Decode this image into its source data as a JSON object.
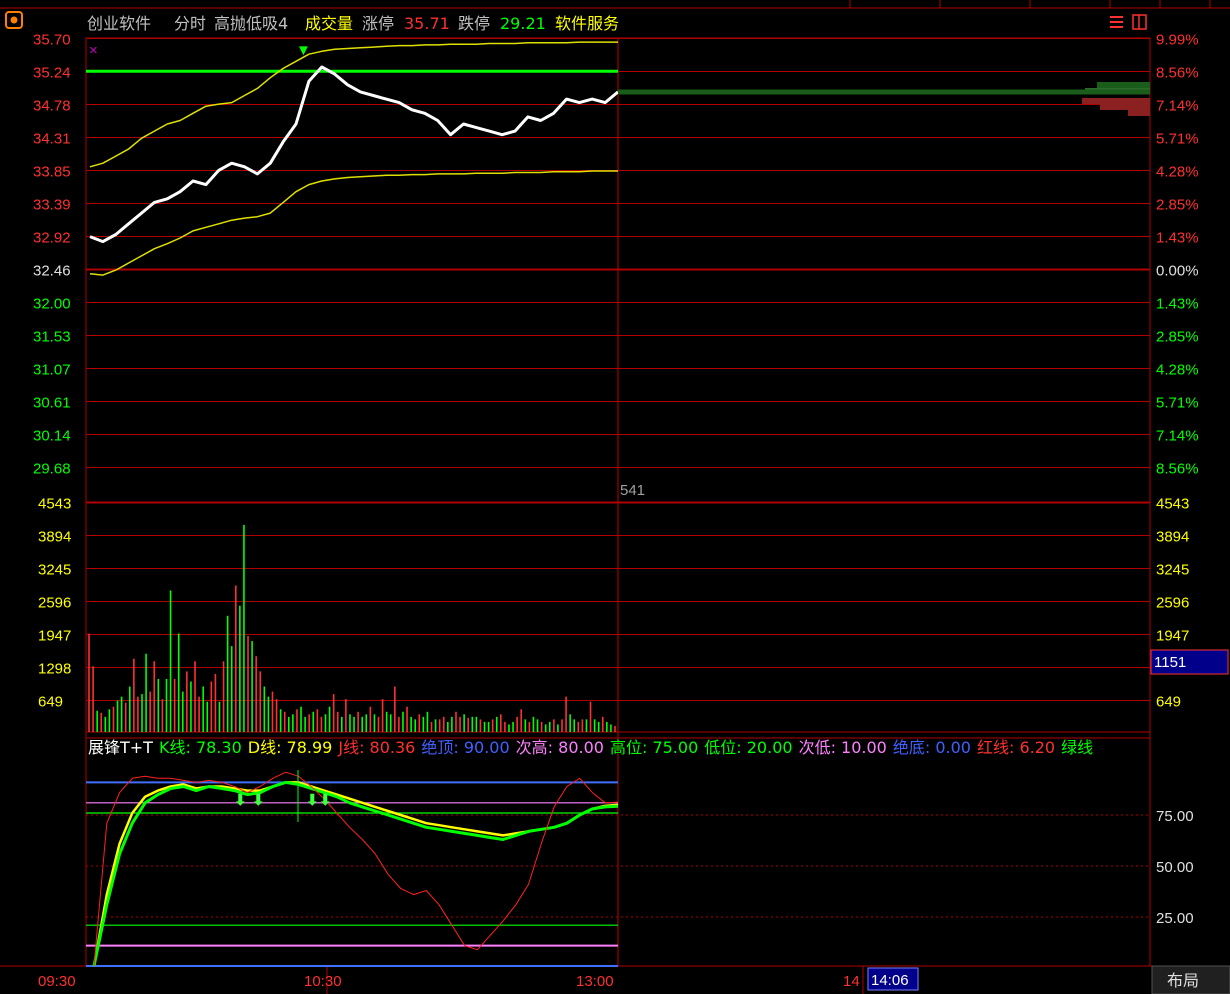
{
  "header": {
    "stock_name": "创业软件",
    "mode": "分时",
    "indicator": "高抛低吸4",
    "volume_label": "成交量",
    "limit_up_label": "涨停",
    "limit_up_value": "35.71",
    "limit_down_label": "跌停",
    "limit_down_value": "29.21",
    "sector": "软件服务"
  },
  "price_axis": {
    "left": [
      "35.70",
      "35.24",
      "34.78",
      "34.31",
      "33.85",
      "33.39",
      "32.92",
      "32.46",
      "32.00",
      "31.53",
      "31.07",
      "30.61",
      "30.14",
      "29.68"
    ],
    "right": [
      "9.99%",
      "8.56%",
      "7.14%",
      "5.71%",
      "4.28%",
      "2.85%",
      "1.43%",
      "0.00%",
      "1.43%",
      "2.85%",
      "4.28%",
      "5.71%",
      "7.14%",
      "8.56%"
    ]
  },
  "volume_axis": {
    "labels": [
      "4543",
      "3894",
      "3245",
      "2596",
      "1947",
      "1298",
      "649"
    ],
    "current_label": "541",
    "highlight_value": "1151"
  },
  "kd_legend": [
    {
      "text": "展锋T+T",
      "color": "#ffffff"
    },
    {
      "text": "K线: 78.30",
      "color": "#00ff00"
    },
    {
      "text": "D线: 78.99",
      "color": "#ffff00"
    },
    {
      "text": "J线: 80.36",
      "color": "#ff3030"
    },
    {
      "text": "绝顶: 90.00",
      "color": "#4060ff"
    },
    {
      "text": "次高: 80.00",
      "color": "#ff80ff"
    },
    {
      "text": "高位: 75.00",
      "color": "#00ff00"
    },
    {
      "text": "低位: 20.00",
      "color": "#00ff00"
    },
    {
      "text": "次低: 10.00",
      "color": "#ff80ff"
    },
    {
      "text": "绝底: 0.00",
      "color": "#4060ff"
    },
    {
      "text": "红线: 6.20",
      "color": "#ff3030"
    },
    {
      "text": "绿线",
      "color": "#00ff00"
    }
  ],
  "kd_axis": [
    "75.00",
    "50.00",
    "25.00"
  ],
  "time_axis": {
    "labels": [
      "09:30",
      "10:30",
      "13:00",
      "14"
    ],
    "cursor_time": "14:06",
    "layout_button": "布局"
  },
  "chart_data": [
    {
      "type": "line",
      "name_hint": "intraday price",
      "series": [
        {
          "name": "price",
          "values": [
            32.92,
            32.85,
            32.95,
            33.1,
            33.25,
            33.4,
            33.45,
            33.55,
            33.7,
            33.65,
            33.85,
            33.95,
            33.9,
            33.8,
            33.95,
            34.25,
            34.5,
            35.1,
            35.3,
            35.2,
            35.05,
            34.95,
            34.9,
            34.85,
            34.8,
            34.7,
            34.65,
            34.55,
            34.35,
            34.5,
            34.45,
            34.4,
            34.35,
            34.4,
            34.6,
            34.55,
            34.65,
            34.85,
            34.8,
            34.85,
            34.8,
            34.95
          ]
        },
        {
          "name": "upper band",
          "values": [
            33.9,
            33.95,
            34.05,
            34.15,
            34.3,
            34.4,
            34.5,
            34.55,
            34.65,
            34.75,
            34.78,
            34.8,
            34.9,
            35.0,
            35.15,
            35.28,
            35.38,
            35.48,
            35.52,
            35.55,
            35.56,
            35.57,
            35.58,
            35.59,
            35.6,
            35.6,
            35.61,
            35.61,
            35.62,
            35.62,
            35.62,
            35.63,
            35.63,
            35.63,
            35.64,
            35.64,
            35.64,
            35.64,
            35.65,
            35.65,
            35.65,
            35.65
          ]
        },
        {
          "name": "lower band",
          "values": [
            32.4,
            32.38,
            32.45,
            32.55,
            32.65,
            32.75,
            32.82,
            32.9,
            33.0,
            33.05,
            33.1,
            33.15,
            33.18,
            33.2,
            33.25,
            33.4,
            33.55,
            33.65,
            33.7,
            33.73,
            33.75,
            33.76,
            33.77,
            33.78,
            33.78,
            33.79,
            33.79,
            33.8,
            33.8,
            33.8,
            33.81,
            33.81,
            33.81,
            33.82,
            33.82,
            33.82,
            33.83,
            33.83,
            33.83,
            33.84,
            33.84,
            33.84
          ]
        }
      ],
      "ylim": [
        29.68,
        35.7
      ],
      "ref_line": 32.46,
      "limit_line": 35.24
    },
    {
      "type": "bar",
      "name_hint": "volume",
      "values": [
        1947,
        1300,
        420,
        380,
        300,
        450,
        500,
        620,
        700,
        580,
        900,
        1450,
        700,
        750,
        1550,
        800,
        1400,
        1050,
        650,
        1050,
        2800,
        1050,
        1950,
        800,
        1200,
        1000,
        1400,
        700,
        900,
        600,
        1000,
        1150,
        600,
        1400,
        2300,
        1700,
        2900,
        2500,
        4100,
        1900,
        1800,
        1500,
        1200,
        900,
        700,
        800,
        650,
        450,
        400,
        300,
        350,
        450,
        500,
        300,
        350,
        400,
        450,
        300,
        350,
        500,
        750,
        400,
        300,
        650,
        350,
        300,
        400,
        300,
        350,
        500,
        350,
        300,
        650,
        400,
        350,
        900,
        300,
        400,
        500,
        300,
        250,
        350,
        300,
        400,
        200,
        250,
        250,
        300,
        200,
        300,
        400,
        300,
        350,
        280,
        300,
        300,
        250,
        200,
        200,
        250,
        300,
        350,
        200,
        150,
        200,
        300,
        450,
        250,
        200,
        300,
        250,
        200,
        150,
        200,
        250,
        150,
        250,
        700,
        350,
        250,
        200,
        250,
        250,
        600,
        250,
        200,
        300,
        200,
        150,
        120
      ],
      "colors": [
        "red",
        "green"
      ],
      "ylim": [
        0,
        4543
      ]
    },
    {
      "type": "line",
      "name_hint": "KDJ oscillator",
      "series": [
        {
          "name": "K",
          "values": [
            0,
            30,
            55,
            70,
            80,
            84,
            87,
            88,
            86,
            88,
            87,
            86,
            84,
            85,
            88,
            90,
            89,
            87,
            85,
            83,
            80,
            78,
            76,
            74,
            72,
            70,
            68,
            67,
            66,
            65,
            64,
            63,
            62,
            64,
            66,
            67,
            68,
            70,
            74,
            77,
            78,
            78.3
          ]
        },
        {
          "name": "D",
          "values": [
            0,
            35,
            60,
            75,
            83,
            86,
            88,
            89,
            87,
            88,
            88,
            87,
            86,
            86,
            88,
            90,
            90,
            88,
            86,
            84,
            82,
            80,
            78,
            76,
            74,
            72,
            70,
            69,
            68,
            67,
            66,
            65,
            64,
            65,
            66,
            67,
            68,
            70,
            74,
            77,
            78.5,
            78.99
          ]
        },
        {
          "name": "J",
          "values": [
            0,
            70,
            85,
            92,
            93,
            92,
            92,
            91,
            90,
            91,
            90,
            88,
            85,
            88,
            92,
            95,
            93,
            88,
            82,
            75,
            68,
            62,
            55,
            45,
            38,
            35,
            37,
            30,
            20,
            10,
            8,
            15,
            22,
            30,
            40,
            60,
            78,
            88,
            92,
            85,
            80,
            80.36
          ]
        }
      ],
      "ylim": [
        0,
        100
      ],
      "levels": [
        90,
        80,
        75,
        20,
        10,
        0
      ]
    }
  ]
}
